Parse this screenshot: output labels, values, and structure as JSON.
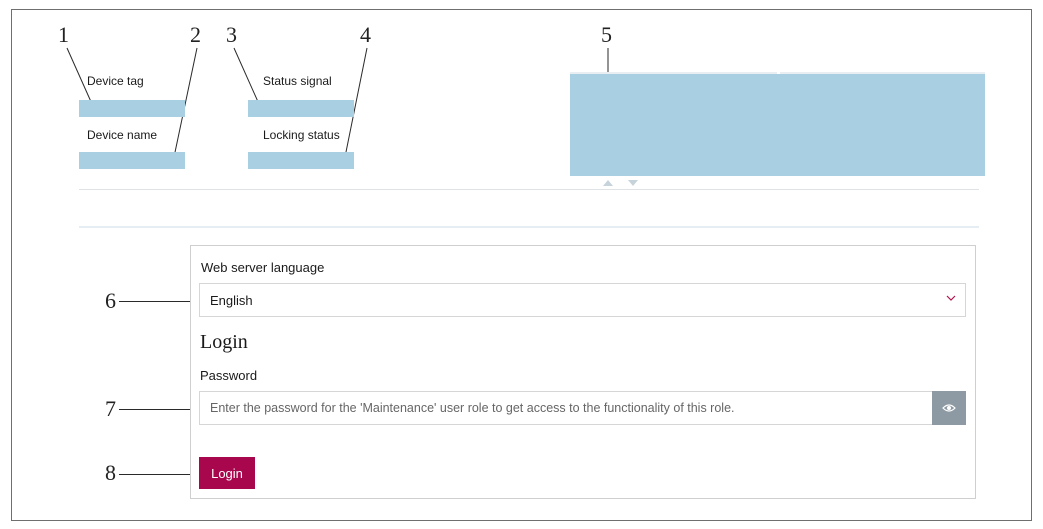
{
  "callouts": [
    "1",
    "2",
    "3",
    "4",
    "5",
    "6",
    "7",
    "8"
  ],
  "header": {
    "device_tag_label": "Device tag",
    "device_name_label": "Device name",
    "status_signal_label": "Status signal",
    "locking_status_label": "Locking status"
  },
  "form": {
    "language_label": "Web server language",
    "language_value": "English",
    "login_heading": "Login",
    "password_label": "Password",
    "password_placeholder": "Enter the password for the 'Maintenance' user role to get access to the functionality of this role.",
    "login_button": "Login"
  },
  "icons": {
    "dropdown": "chevron-down-icon",
    "password_toggle": "eye-icon",
    "scroll_up": "triangle-up-icon",
    "scroll_down": "triangle-down-icon"
  },
  "colors": {
    "field_fill": "#a9cfe3",
    "accent": "#a8064d",
    "chevron": "#b2134f",
    "toggle_bg": "#8d9aa3"
  }
}
